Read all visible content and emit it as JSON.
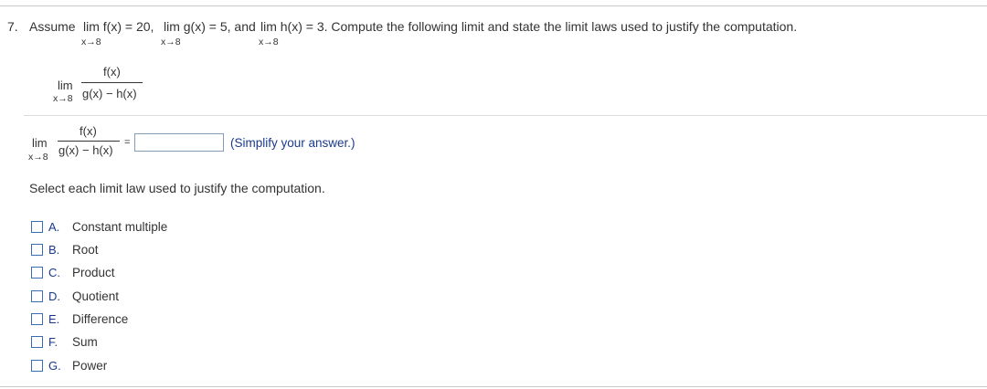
{
  "question": {
    "number": "7.",
    "assume_label": "Assume",
    "lim1": "lim f(x) = 20,",
    "lim2": "lim g(x) = 5, and",
    "lim3": "lim h(x) = 3. Compute the following limit and state the limit laws used to justify the computation.",
    "approach": "x→8"
  },
  "expression": {
    "lim": "lim",
    "approach": "x→8",
    "numerator": "f(x)",
    "denominator": "g(x) − h(x)"
  },
  "answer": {
    "lim": "lim",
    "approach": "x→8",
    "numerator": "f(x)",
    "denominator": "g(x) − h(x)",
    "equals": "=",
    "input_value": "",
    "hint": "(Simplify your answer.)"
  },
  "laws": {
    "prompt": "Select each limit law used to justify the computation.",
    "options": [
      {
        "letter": "A.",
        "text": "Constant multiple"
      },
      {
        "letter": "B.",
        "text": "Root"
      },
      {
        "letter": "C.",
        "text": "Product"
      },
      {
        "letter": "D.",
        "text": "Quotient"
      },
      {
        "letter": "E.",
        "text": "Difference"
      },
      {
        "letter": "F.",
        "text": "Sum"
      },
      {
        "letter": "G.",
        "text": "Power"
      }
    ]
  },
  "colors": {
    "accent": "#1a3a8f",
    "checkbox_border": "#3a6bb5",
    "rule": "#c9c9c9"
  }
}
